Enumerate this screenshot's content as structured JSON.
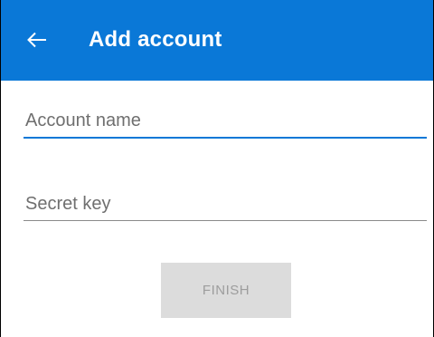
{
  "app_bar": {
    "title": "Add account",
    "back_icon": "arrow-left-icon",
    "background_color": "#0a78d7"
  },
  "form": {
    "account_name": {
      "placeholder": "Account name",
      "value": "",
      "focused": true,
      "accent_color": "#0a78d7"
    },
    "secret_key": {
      "placeholder": "Secret key",
      "value": ""
    },
    "finish_button": {
      "label": "FINISH",
      "enabled": false
    }
  }
}
